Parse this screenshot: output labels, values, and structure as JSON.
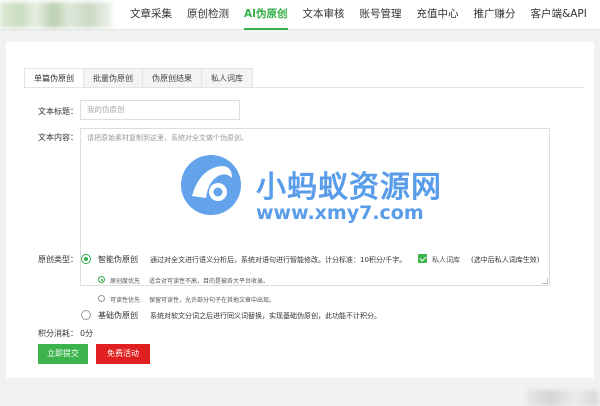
{
  "nav": {
    "items": [
      "文章采集",
      "原创检测",
      "AI伪原创",
      "文本审核",
      "账号管理",
      "充值中心",
      "推广赚分",
      "客户端&API"
    ],
    "active_index": 2
  },
  "tabs": [
    "单篇伪原创",
    "批量伪原创",
    "伪原创结果",
    "私人词库"
  ],
  "form": {
    "title_label": "文本标题：",
    "title_placeholder": "我的伪原创",
    "content_label": "文本内容：",
    "content_placeholder": "请把原始素材复制到这里，系统对全文做个伪原创。",
    "type_label": "原创类型：",
    "smart_option": "智能伪原创",
    "smart_desc": "通过对全文进行语义分析后，系统对语句进行智能修改。计分标准：10积分/千字。",
    "private_lexicon_label": "私人词库",
    "private_lexicon_note": "(选中后私人词库生效)",
    "sub_options": [
      {
        "label": "原创度优先",
        "desc": "适合对可读性不高，目的是被各大平台收录。",
        "selected": true
      },
      {
        "label": "可读性优先",
        "desc": "保留可读性，允许部分句子在其他文章中出现。",
        "selected": false
      }
    ],
    "basic_option": "基础伪原创",
    "basic_desc": "系统对软文分词之后进行同义词替换，实现基础伪原创，此功能不计积分。",
    "points_label": "积分消耗：",
    "points_value": "0分",
    "submit_label": "立即提交",
    "free_label": "免费活动"
  },
  "watermark": {
    "cn": "小蚂蚁资源网",
    "url": "www.xmy7.com"
  },
  "colors": {
    "accent": "#33b04a",
    "danger": "#e02020",
    "watermark": "#3c8ce6"
  }
}
